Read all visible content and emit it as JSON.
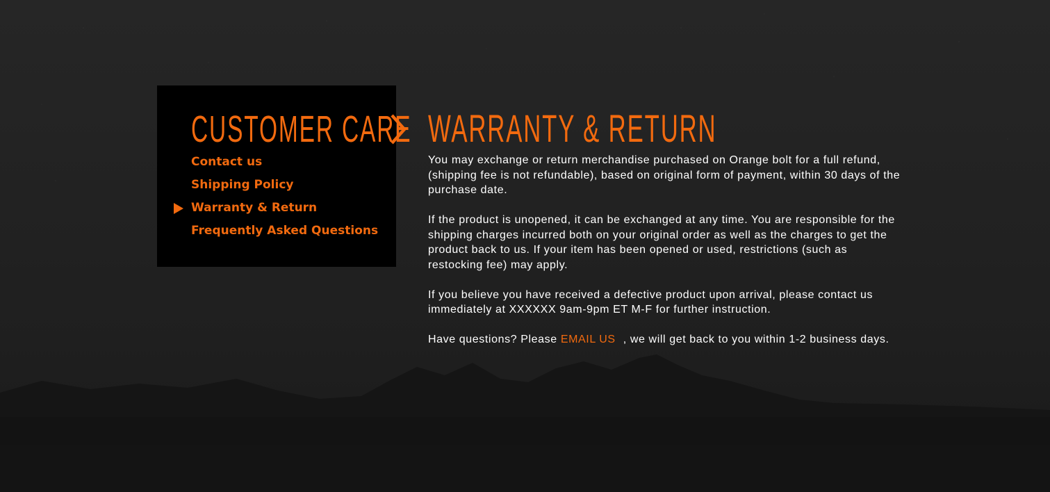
{
  "sidebar": {
    "title": "CUSTOMER CARE",
    "items": [
      {
        "label": "Contact us",
        "active": false
      },
      {
        "label": "Shipping Policy",
        "active": false
      },
      {
        "label": "Warranty & Return",
        "active": true
      },
      {
        "label": "Frequently Asked Questions",
        "active": false
      }
    ]
  },
  "content": {
    "title": "WARRANTY & RETURN",
    "para1": {
      "line1": "You may exchange or return merchandise purchased on Orange bolt for a full refund,",
      "line2": "(shipping fee is not refundable), based on original form of payment, within 30 days of the",
      "line3": "purchase date."
    },
    "para2": {
      "line1": "If the product is unopened, it can be exchanged at any time.  You are responsible for the",
      "line2": "shipping charges incurred both on your original order as well as the charges to get the",
      "line3": "product back to us.  If your item has been opened or used, restrictions (such as",
      "line4": "restocking fee) may apply."
    },
    "para3": {
      "line1": "If you believe you have received a defective product upon arrival, please contact us",
      "line2": "immediately at XXXXXX 9am-9pm ET M-F for further instruction."
    },
    "para4": {
      "before": "Have questions? Please ",
      "link": "EMAIL US",
      "after": " , we will get back to you within 1-2 business days."
    }
  },
  "icons": {
    "chevron": "chevron-right-icon",
    "active_marker": "triangle-right-icon"
  },
  "colors": {
    "accent": "#f26a0f",
    "panel": "#000000",
    "text": "#ffffff"
  }
}
